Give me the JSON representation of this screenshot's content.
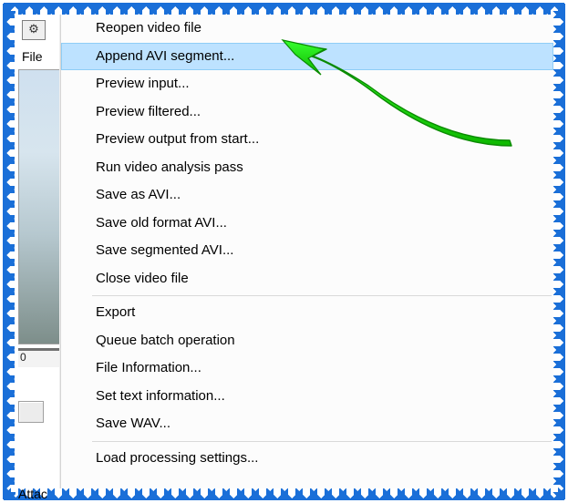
{
  "app": {
    "menu_file_label": "File",
    "ruler_text": "0",
    "attach_label": "Attac"
  },
  "icons": {
    "toolbar_process": "⚙"
  },
  "menu": {
    "highlighted_index": 1,
    "groups": [
      {
        "items": [
          {
            "label": "Reopen video file"
          },
          {
            "label": "Append AVI segment..."
          },
          {
            "label": "Preview input..."
          },
          {
            "label": "Preview filtered..."
          },
          {
            "label": "Preview output from start..."
          },
          {
            "label": "Run video analysis pass"
          },
          {
            "label": "Save as AVI..."
          },
          {
            "label": "Save old format AVI..."
          },
          {
            "label": "Save segmented AVI..."
          },
          {
            "label": "Close video file"
          }
        ]
      },
      {
        "items": [
          {
            "label": "Export"
          },
          {
            "label": "Queue batch operation"
          },
          {
            "label": "File Information..."
          },
          {
            "label": "Set text information..."
          },
          {
            "label": "Save WAV..."
          }
        ]
      },
      {
        "items": [
          {
            "label": "Load processing settings..."
          }
        ]
      }
    ]
  },
  "annotation": {
    "arrow_color": "#17d400"
  }
}
